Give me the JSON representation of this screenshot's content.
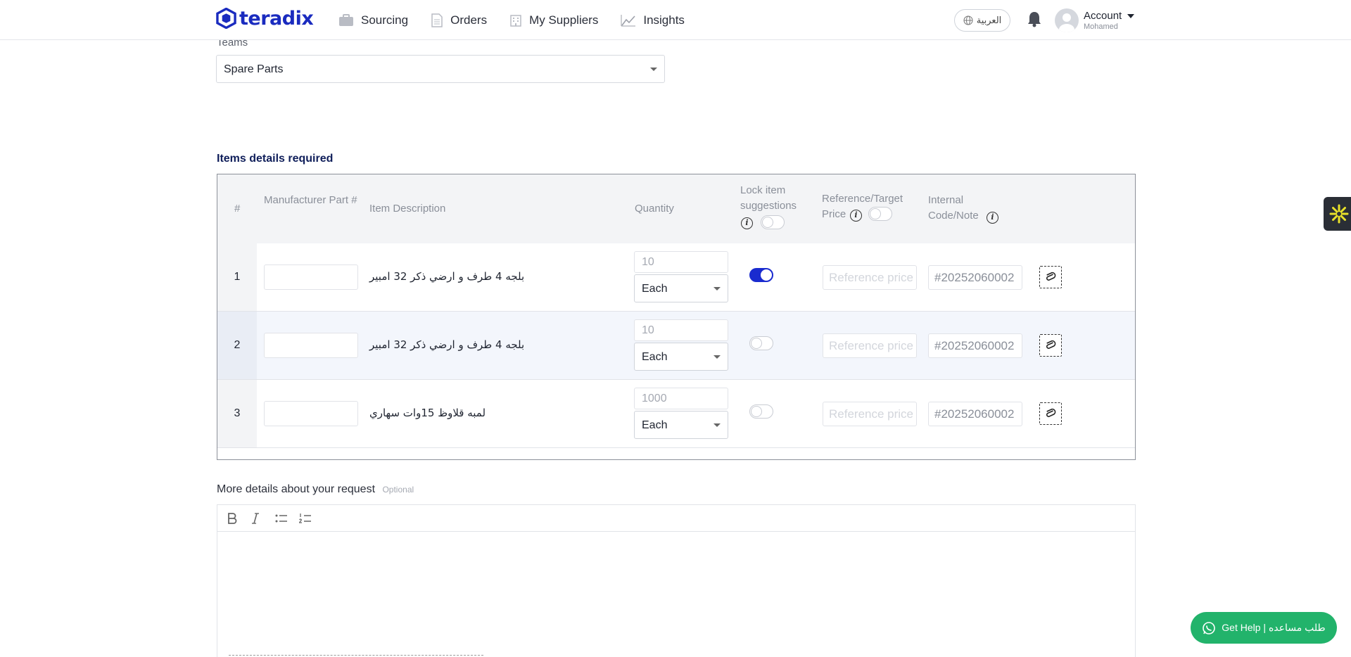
{
  "header": {
    "logo_text": "teradix",
    "nav": [
      {
        "label": "Sourcing",
        "icon": "briefcase-icon"
      },
      {
        "label": "Orders",
        "icon": "document-icon"
      },
      {
        "label": "My Suppliers",
        "icon": "building-icon"
      },
      {
        "label": "Insights",
        "icon": "chart-line-icon"
      }
    ],
    "language_label": "العربية",
    "account_label": "Account",
    "account_user": "Mohamed"
  },
  "teams": {
    "label": "Teams",
    "value": "Spare Parts"
  },
  "items": {
    "title": "Items details required",
    "columns": {
      "num": "#",
      "mpn": "Manufacturer Part #",
      "description": "Item Description",
      "quantity": "Quantity",
      "lock": "Lock item suggestions",
      "ref_price": "Reference/Target Price",
      "code": "Internal Code/Note"
    },
    "rows": [
      {
        "num": "1",
        "description": "بلجه 4 طرف و ارضي ذكر 32 امبير",
        "quantity": "10",
        "unit": "Each",
        "lock_on": true,
        "ref_placeholder": "Reference price",
        "code_value": "#20252060002"
      },
      {
        "num": "2",
        "description": "بلجه 4 طرف و ارضي ذكر 32 امبير",
        "quantity": "10",
        "unit": "Each",
        "lock_on": false,
        "ref_placeholder": "Reference price",
        "code_value": "#20252060002"
      },
      {
        "num": "3",
        "description": "لمبه قلاوظ 15وات سهاري",
        "quantity": "1000",
        "unit": "Each",
        "lock_on": false,
        "ref_placeholder": "Reference price",
        "code_value": "#20252060002"
      }
    ]
  },
  "details": {
    "label": "More details about your request",
    "optional": "Optional",
    "toolbar": [
      "bold-icon",
      "italic-icon",
      "bullet-list-icon",
      "numbered-list-icon"
    ]
  },
  "help_button": "Get Help | طلب مساعده",
  "colors": {
    "brand": "#1a2bbf",
    "toggle_on": "#1a2bcf",
    "help": "#22b36b",
    "title": "#0f1e5a"
  }
}
